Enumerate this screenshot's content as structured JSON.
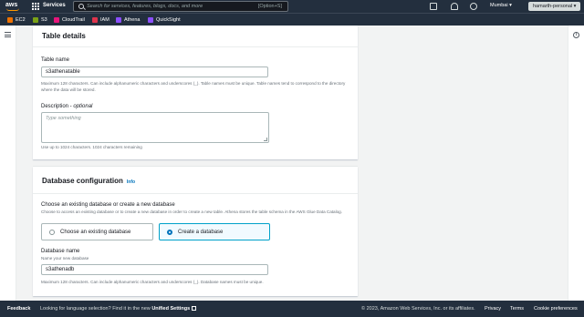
{
  "topnav": {
    "logo_text": "aws",
    "services_label": "Services",
    "search_placeholder": "Search for services, features, blogs, docs, and more",
    "search_shortcut": "[Option+S]",
    "region": "Mumbai ▾",
    "account": "hamarth-personal ▾",
    "icons": [
      "cloudshell-icon",
      "bell-icon",
      "help-icon"
    ]
  },
  "favorites": [
    {
      "label": "EC2",
      "color": "#ed7100"
    },
    {
      "label": "S3",
      "color": "#7aa116"
    },
    {
      "label": "CloudTrail",
      "color": "#e7157b"
    },
    {
      "label": "IAM",
      "color": "#dd344c"
    },
    {
      "label": "Athena",
      "color": "#8c4fff"
    },
    {
      "label": "QuickSight",
      "color": "#8c4fff"
    }
  ],
  "table_details": {
    "heading": "Table details",
    "table_name_label": "Table name",
    "table_name_value": "s3athenatable",
    "table_name_hint": "Maximum 128 characters. Can include alphanumeric characters and underscores (_). Table names must be unique. Table names tend to correspond to the directory where the data will be stored.",
    "description_label": "Description - ",
    "description_optional": "optional",
    "description_placeholder": "Type something",
    "description_hint": "Use up to 1024 characters. 1024 characters remaining"
  },
  "database_config": {
    "heading": "Database configuration",
    "info_label": "Info",
    "choose_label": "Choose an existing database or create a new database",
    "choose_hint": "Choose to access an existing database or to create a new database in order to create a new table. Athena stores the table schema in the AWS Glue Data Catalog.",
    "options": [
      {
        "label": "Choose an existing database",
        "selected": false
      },
      {
        "label": "Create a database",
        "selected": true
      }
    ],
    "db_name_label": "Database name",
    "db_name_sublabel": "Name your new database",
    "db_name_value": "s3athenadb",
    "db_name_hint": "Maximum 128 characters. Can include alphanumeric characters and underscores (_). Database names must be unique."
  },
  "footer": {
    "feedback": "Feedback",
    "lang_text": "Looking for language selection? Find it in the new ",
    "lang_link": "Unified Settings",
    "copyright": "© 2023, Amazon Web Services, Inc. or its affiliates.",
    "privacy": "Privacy",
    "terms": "Terms",
    "cookies": "Cookie preferences"
  }
}
